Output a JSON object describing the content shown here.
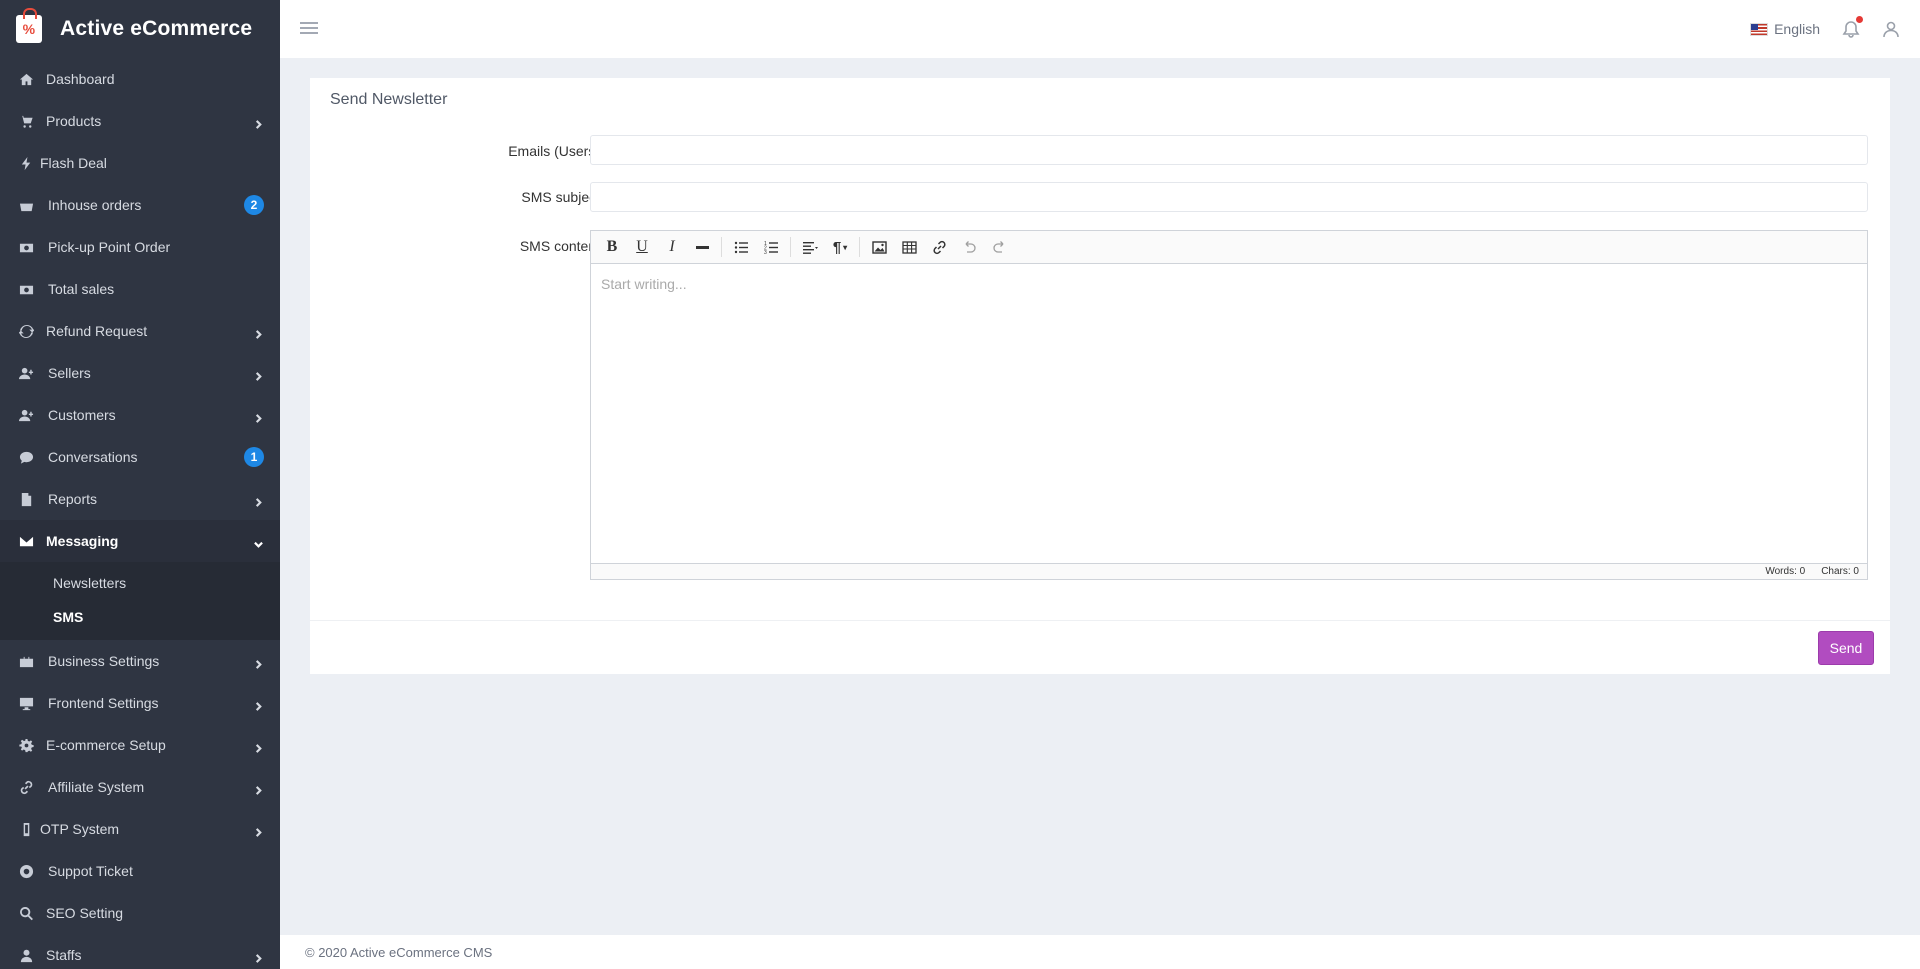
{
  "brand": {
    "name": "Active eCommerce"
  },
  "sidebar": {
    "items": [
      {
        "label": "Dashboard",
        "icon": "home-icon"
      },
      {
        "label": "Products",
        "icon": "cart-icon"
      },
      {
        "label": "Flash Deal",
        "icon": "bolt-icon"
      },
      {
        "label": "Inhouse orders",
        "icon": "basket-icon",
        "badge": "2"
      },
      {
        "label": "Pick-up Point Order",
        "icon": "money-icon"
      },
      {
        "label": "Total sales",
        "icon": "money-icon"
      },
      {
        "label": "Refund Request",
        "icon": "refresh-icon"
      },
      {
        "label": "Sellers",
        "icon": "user-plus-icon"
      },
      {
        "label": "Customers",
        "icon": "user-plus-icon"
      },
      {
        "label": "Conversations",
        "icon": "chat-icon",
        "badge": "1"
      },
      {
        "label": "Reports",
        "icon": "file-icon"
      },
      {
        "label": "Messaging",
        "icon": "envelope-icon"
      },
      {
        "label": "Business Settings",
        "icon": "briefcase-icon"
      },
      {
        "label": "Frontend Settings",
        "icon": "desktop-icon"
      },
      {
        "label": "E-commerce Setup",
        "icon": "gear-icon"
      },
      {
        "label": "Affiliate System",
        "icon": "link-icon"
      },
      {
        "label": "OTP System",
        "icon": "mobile-icon"
      },
      {
        "label": "Suppot Ticket",
        "icon": "lifebuoy-icon"
      },
      {
        "label": "SEO Setting",
        "icon": "search-icon"
      },
      {
        "label": "Staffs",
        "icon": "user-icon"
      }
    ],
    "messaging_sub": [
      {
        "label": "Newsletters"
      },
      {
        "label": "SMS"
      }
    ]
  },
  "topbar": {
    "language": "English"
  },
  "form": {
    "title": "Send Newsletter",
    "emails_label": "Emails (Users)",
    "emails_value": "",
    "subject_label": "SMS subject",
    "subject_value": "",
    "content_label": "SMS content",
    "editor_placeholder": "Start writing...",
    "words": "Words: 0",
    "chars": "Chars: 0",
    "send_label": "Send"
  },
  "footer": {
    "copyright": "© 2020 Active eCommerce CMS"
  },
  "colors": {
    "sidebar": "#2f3542",
    "accent": "#b14cc0",
    "badge": "#1e88e5"
  }
}
